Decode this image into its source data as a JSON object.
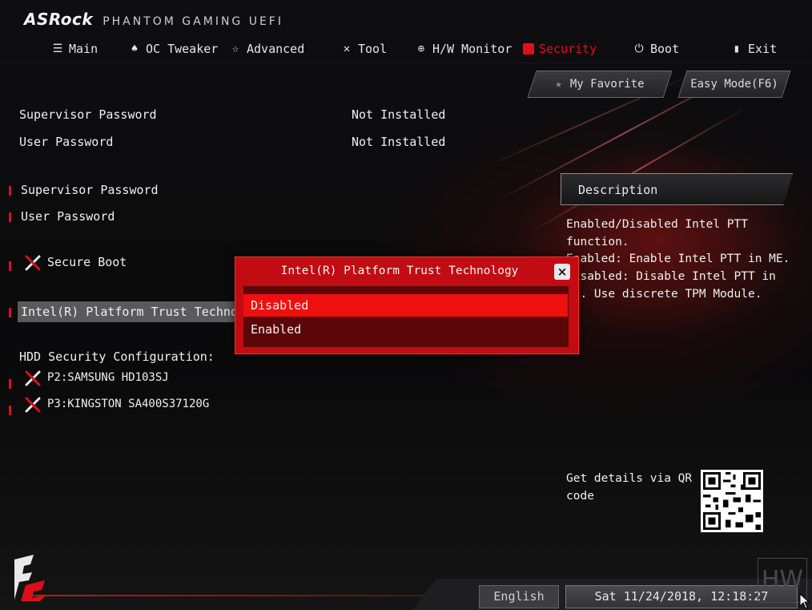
{
  "brand": {
    "name": "ASRock",
    "subtitle": "PHANTOM GAMING UEFI"
  },
  "nav": [
    {
      "id": "main",
      "label": "Main",
      "icon": "list-icon",
      "active": false
    },
    {
      "id": "oc",
      "label": "OC Tweaker",
      "icon": "flame-icon",
      "active": false
    },
    {
      "id": "advanced",
      "label": "Advanced",
      "icon": "star-icon",
      "active": false
    },
    {
      "id": "tool",
      "label": "Tool",
      "icon": "tools-icon",
      "active": false
    },
    {
      "id": "hw",
      "label": "H/W Monitor",
      "icon": "monitor-icon",
      "active": false
    },
    {
      "id": "security",
      "label": "Security",
      "icon": "shield-icon",
      "active": true
    },
    {
      "id": "boot",
      "label": "Boot",
      "icon": "power-icon",
      "active": false
    },
    {
      "id": "exit",
      "label": "Exit",
      "icon": "exit-icon",
      "active": false
    }
  ],
  "top_buttons": {
    "favorite": "My Favorite",
    "easy_mode": "Easy Mode(F6)"
  },
  "status": [
    {
      "label": "Supervisor Password",
      "value": "Not Installed"
    },
    {
      "label": "User Password",
      "value": "Not Installed"
    }
  ],
  "menu": {
    "supervisor_password": "Supervisor Password",
    "user_password": "User Password",
    "secure_boot": "Secure Boot",
    "intel_ptt": "Intel(R) Platform Trust Technolog",
    "hdd_heading": "HDD Security Configuration:",
    "drives": [
      "P2:SAMSUNG HD103SJ",
      "P3:KINGSTON SA400S37120G"
    ]
  },
  "description": {
    "title": "Description",
    "text": "Enabled/Disabled Intel PTT\nfunction.\nEnabled: Enable Intel PTT in ME.\nDisabled: Disable Intel PTT in\nME. Use discrete TPM Module."
  },
  "qr": {
    "text": "Get details via QR code"
  },
  "dialog": {
    "title": "Intel(R) Platform Trust Technology",
    "close": "×",
    "options": [
      {
        "label": "Disabled",
        "selected": true
      },
      {
        "label": "Enabled",
        "selected": false
      }
    ]
  },
  "footer": {
    "language": "English",
    "datetime": "Sat 11/24/2018, 12:18:27",
    "hw_mark": "HW"
  },
  "colors": {
    "accent": "#e0101a",
    "dialog": "#c20b12",
    "selected": "#f00f0f"
  }
}
